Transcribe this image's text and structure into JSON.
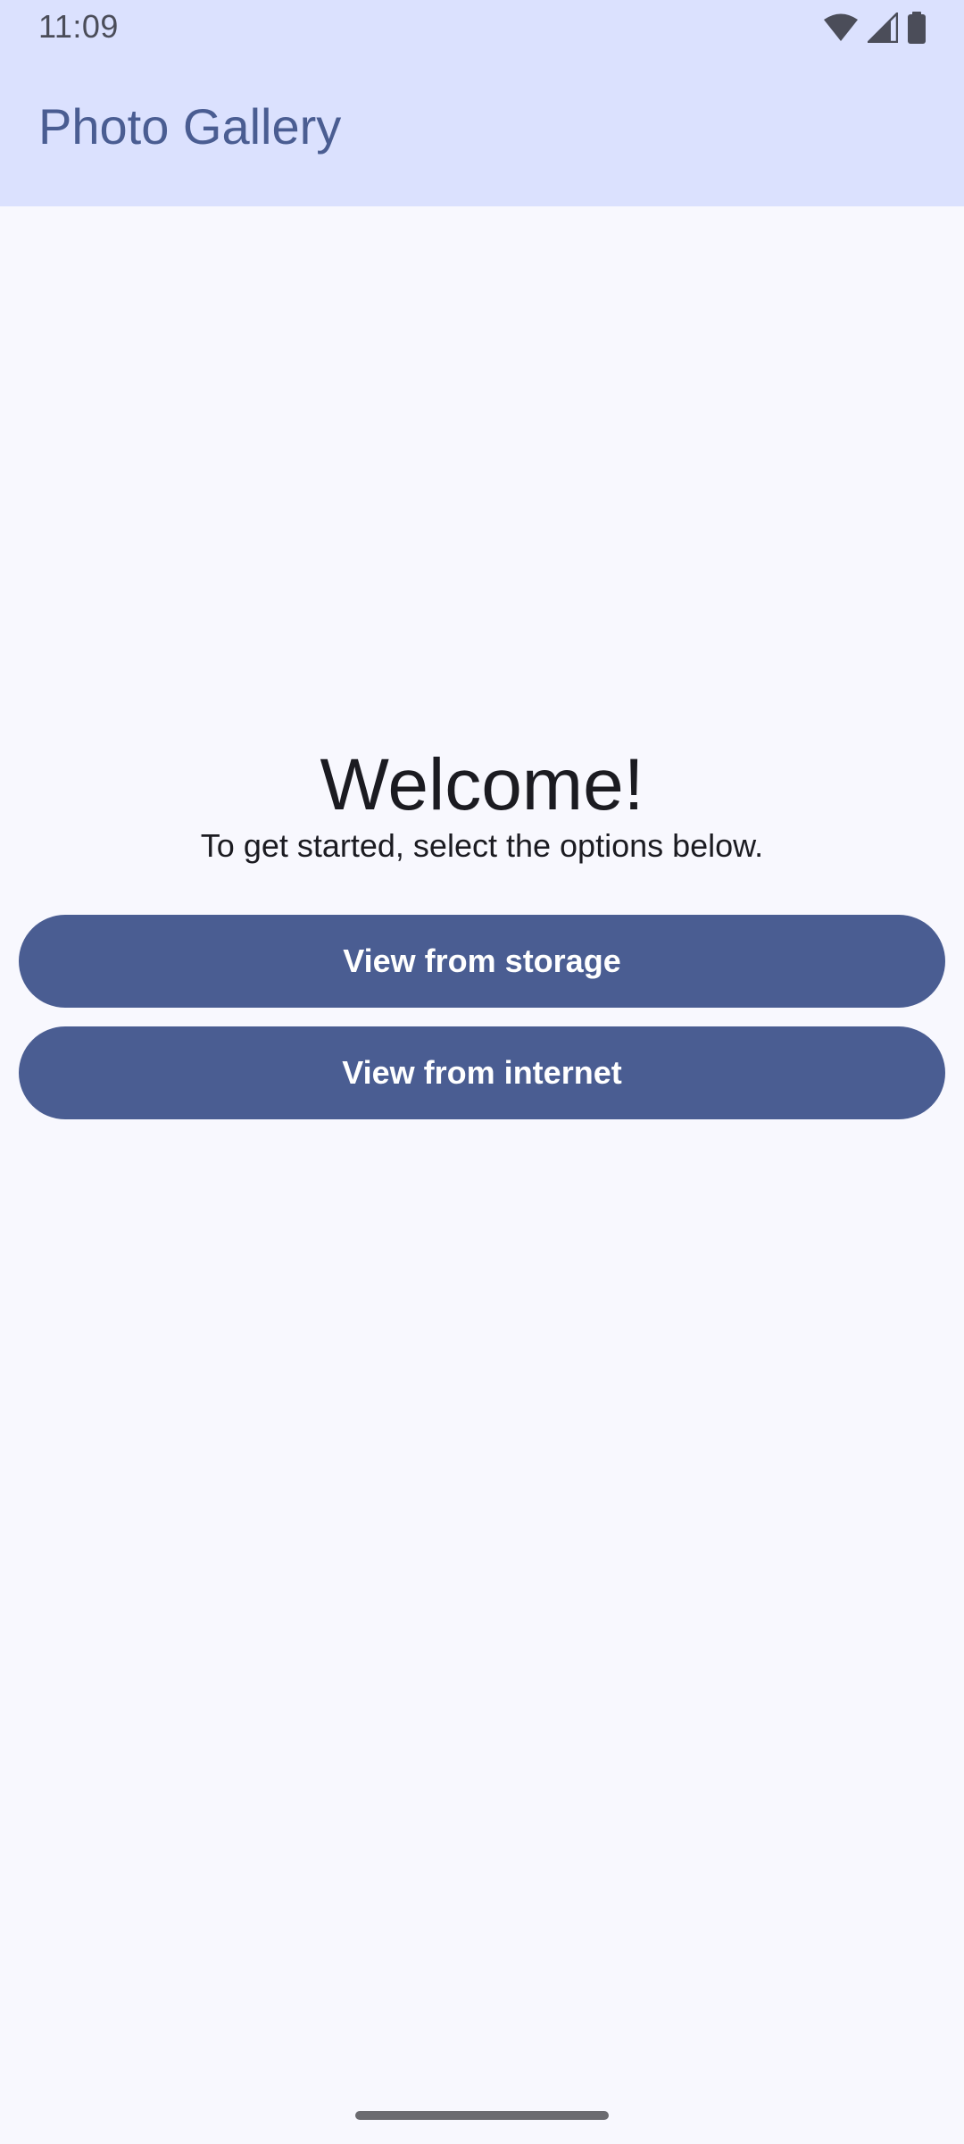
{
  "status_bar": {
    "time": "11:09",
    "icons": [
      "wifi-icon",
      "cellular-signal-icon",
      "battery-icon"
    ]
  },
  "app_bar": {
    "title": "Photo Gallery"
  },
  "main": {
    "heading": "Welcome!",
    "subtitle": "To get started, select the options below.",
    "buttons": [
      {
        "label": "View from storage"
      },
      {
        "label": "View from internet"
      }
    ]
  },
  "colors": {
    "app_bar_bg": "#DBE1FE",
    "background": "#F8F8FE",
    "primary": "#4A5D92",
    "on_primary": "#FFFFFF",
    "text": "#1B1B21"
  }
}
